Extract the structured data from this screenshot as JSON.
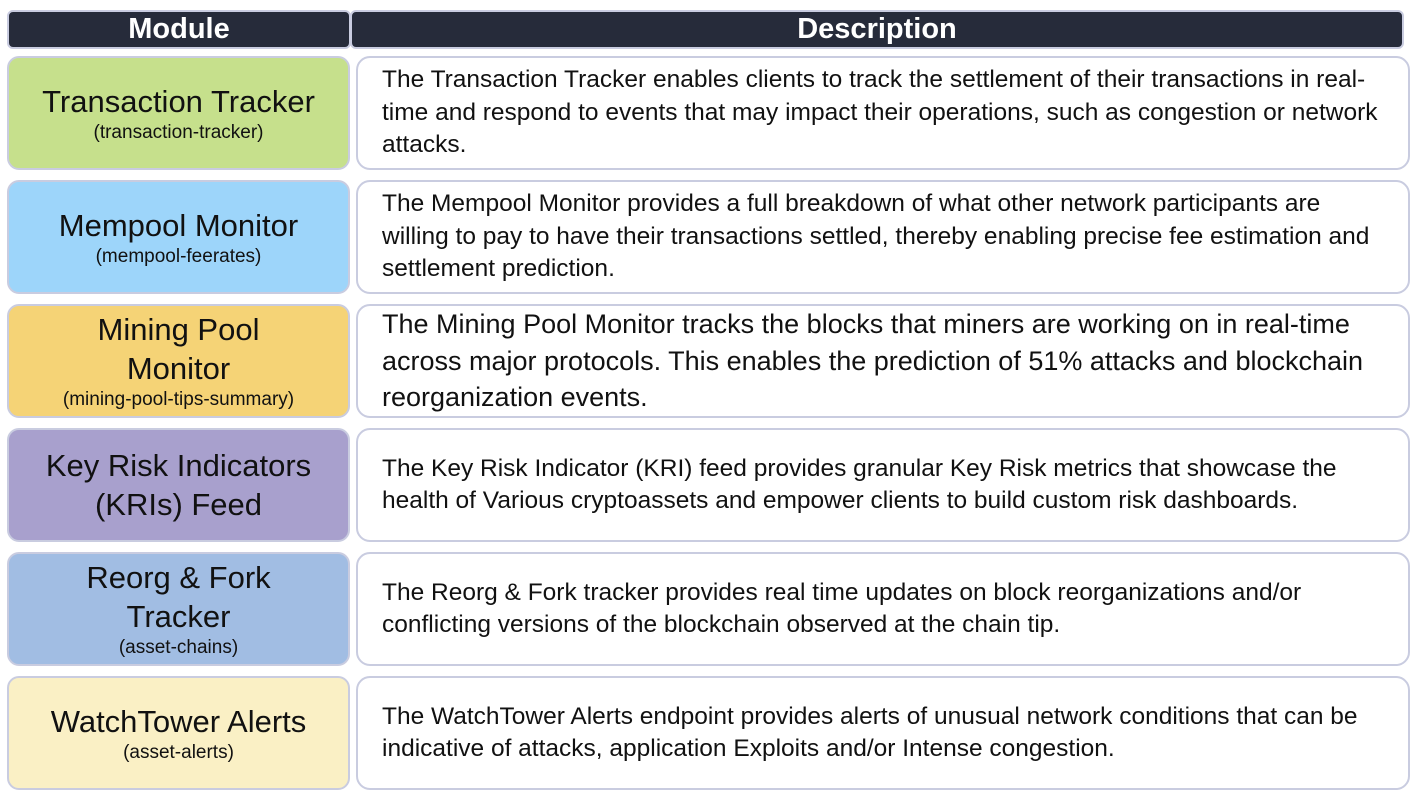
{
  "header": {
    "module_label": "Module",
    "description_label": "Description"
  },
  "rows": [
    {
      "title": "Transaction Tracker",
      "subtitle": "(transaction-tracker)",
      "description": "The Transaction Tracker enables clients to track the settlement of their transactions in real-time and respond to events that may impact their operations, such as congestion or network attacks.",
      "color": "#c6e08c"
    },
    {
      "title": "Mempool Monitor",
      "subtitle": "(mempool-feerates)",
      "description": "The Mempool Monitor provides a full breakdown of what other network participants are willing to pay to have their transactions settled, thereby enabling precise fee estimation and settlement prediction.",
      "color": "#9dd5fa"
    },
    {
      "title": "Mining Pool Monitor",
      "subtitle": "(mining-pool-tips-summary)",
      "description": "The Mining Pool Monitor tracks the blocks that miners are working on in real-time across major protocols. This enables the prediction of 51% attacks and blockchain reorganization events.",
      "color": "#f5d376"
    },
    {
      "title": "Key Risk Indicators (KRIs) Feed",
      "subtitle": "",
      "description": "The Key Risk Indicator (KRI) feed provides granular Key Risk metrics that showcase the health of Various cryptoassets and empower clients to build custom risk dashboards.",
      "color": "#a8a0cd"
    },
    {
      "title": "Reorg & Fork Tracker",
      "subtitle": "(asset-chains)",
      "description": "The Reorg & Fork tracker provides real time updates on block reorganizations and/or conflicting versions of the blockchain observed at the chain tip.",
      "color": "#a1bde3"
    },
    {
      "title": "WatchTower Alerts",
      "subtitle": "(asset-alerts)",
      "description": "The WatchTower Alerts endpoint provides alerts of unusual network conditions that can be indicative of attacks, application Exploits and/or Intense congestion.",
      "color": "#faf0c5"
    }
  ]
}
